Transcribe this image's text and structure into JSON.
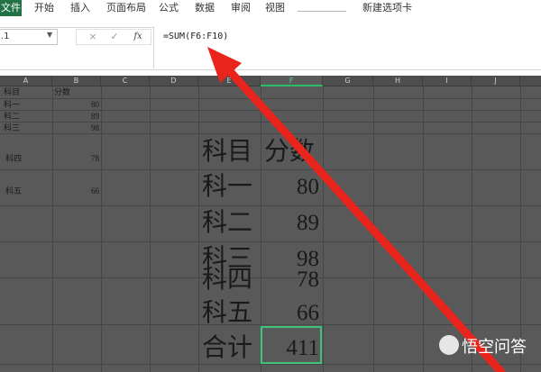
{
  "ribbon": {
    "file_tab": "文件",
    "tabs": [
      "开始",
      "插入",
      "页面布局",
      "公式",
      "数据",
      "审阅",
      "视图",
      "新建选项卡"
    ]
  },
  "formula_bar": {
    "name_box": ".1",
    "cancel_symbol": "×",
    "enter_symbol": "✓",
    "fx_label": "fx",
    "formula": "=SUM(F6:F10)"
  },
  "columns": [
    "A",
    "B",
    "C",
    "D",
    "E",
    "F",
    "G",
    "H",
    "I",
    "J"
  ],
  "selected_column": "F",
  "small_table": {
    "header": {
      "subject": "科目",
      "score": "分数"
    },
    "rows": [
      {
        "subject": "科一",
        "score": "80"
      },
      {
        "subject": "科二",
        "score": "89"
      },
      {
        "subject": "科三",
        "score": "98"
      },
      {
        "subject": "科四",
        "score": "78"
      },
      {
        "subject": "科五",
        "score": "66"
      }
    ]
  },
  "large_table": {
    "header": {
      "subject": "科目",
      "score": "分数"
    },
    "rows": [
      {
        "subject": "科一",
        "score": "80"
      },
      {
        "subject": "科二",
        "score": "89"
      },
      {
        "subject": "科三",
        "score": "98"
      },
      {
        "subject": "科四",
        "score": "78"
      },
      {
        "subject": "科五",
        "score": "66"
      }
    ],
    "total": {
      "label": "合计",
      "value": "411"
    }
  },
  "annotation": {
    "arrow_color": "#e8241c"
  },
  "watermark": {
    "text": "悟空问答"
  },
  "colors": {
    "accent": "#217346",
    "selection": "#3ec47a",
    "sheet_dark": "#595959"
  }
}
